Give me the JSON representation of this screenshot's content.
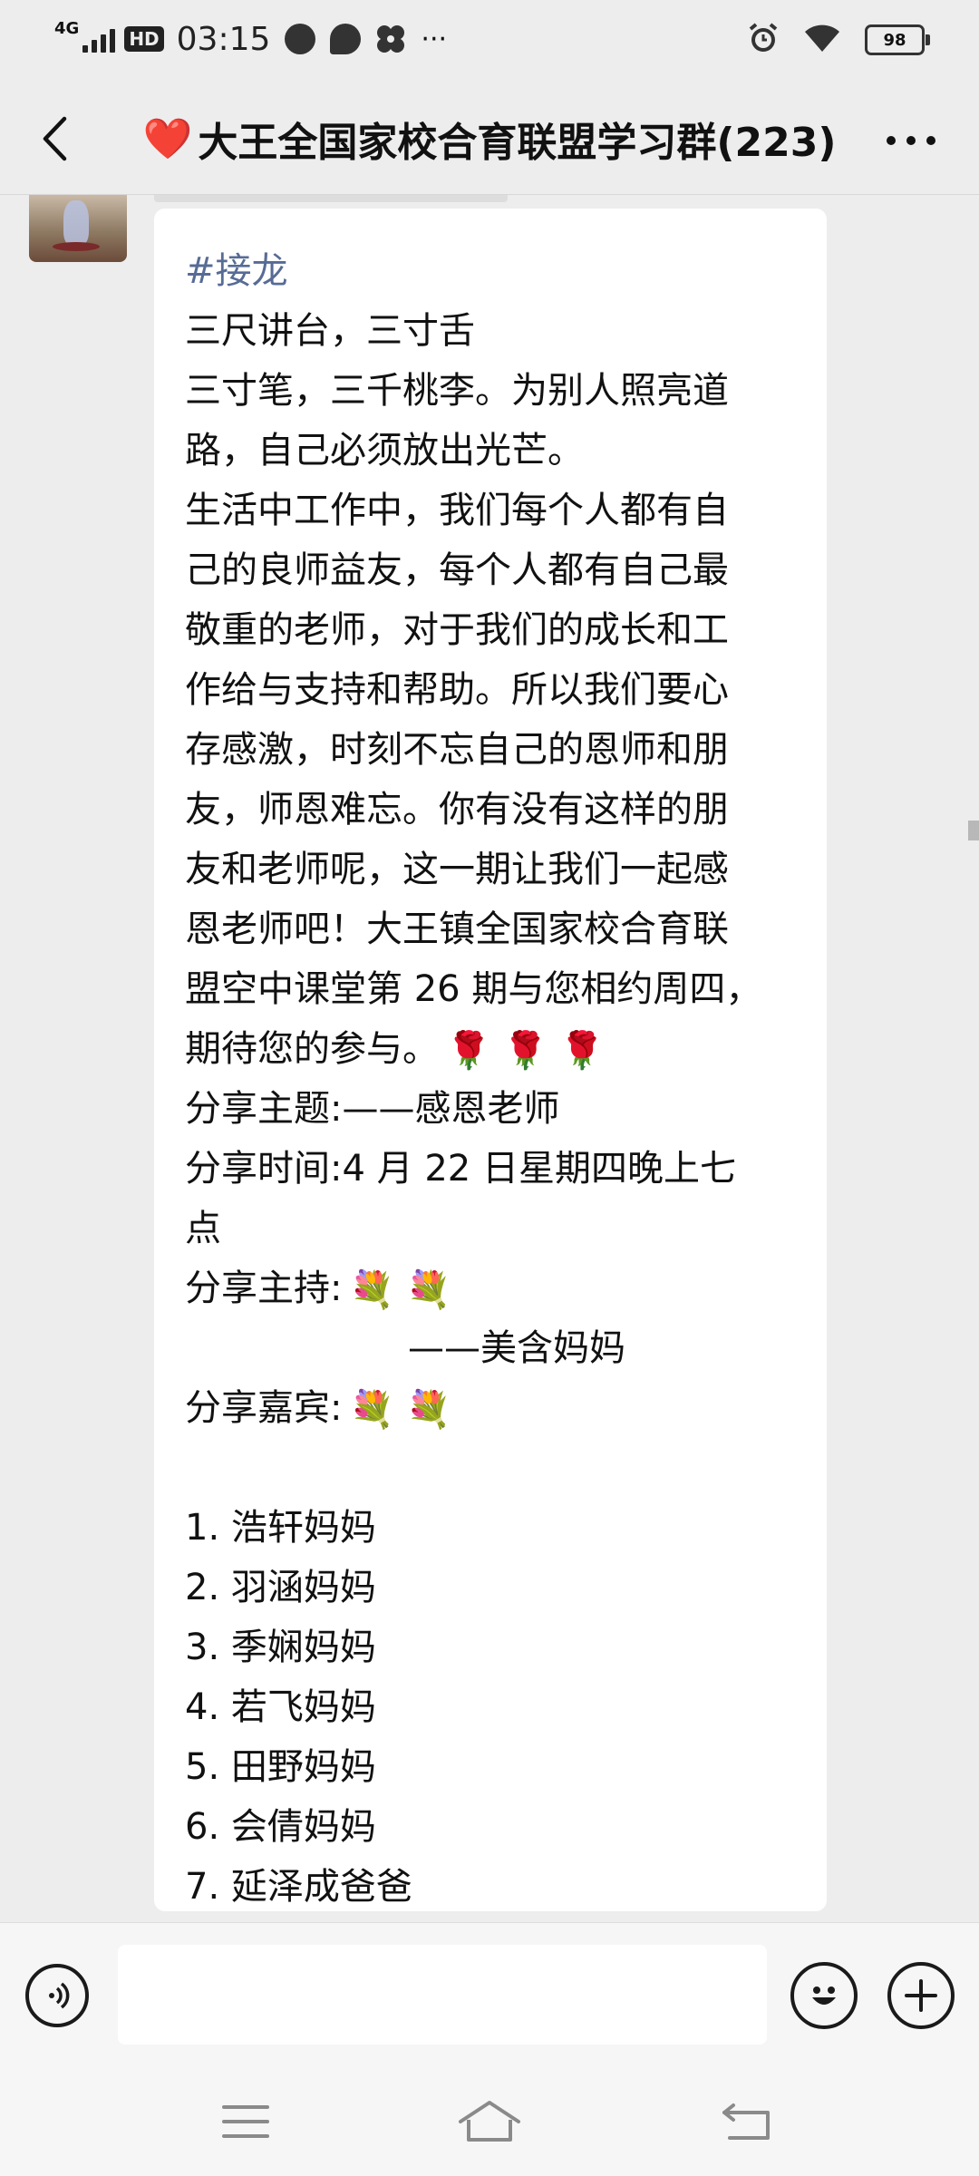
{
  "status_bar": {
    "network": "4G",
    "hd": "HD",
    "time": "03:15",
    "more": "···",
    "battery": "98"
  },
  "header": {
    "title_emoji": "❤️",
    "title": "大王全国家校合育联盟学习群(223)",
    "back_icon": "chevron-left-icon",
    "more_icon": "more-horizontal-icon"
  },
  "message": {
    "lines": [
      {
        "text": "#接龙",
        "style": "tag"
      },
      {
        "text": "三尺讲台，三寸舌"
      },
      {
        "text": "三寸笔，三千桃李。为别人照亮道"
      },
      {
        "text": "路，自己必须放出光芒。"
      },
      {
        "text": "生活中工作中，我们每个人都有自"
      },
      {
        "text": "己的良师益友，每个人都有自己最"
      },
      {
        "text": "敬重的老师，对于我们的成长和工"
      },
      {
        "text": "作给与支持和帮助。所以我们要心"
      },
      {
        "text": "存感激，时刻不忘自己的恩师和朋"
      },
      {
        "text": "友，师恩难忘。你有没有这样的朋"
      },
      {
        "text": "友和老师呢，这一期让我们一起感"
      },
      {
        "text": "恩老师吧！大王镇全国家校合育联"
      },
      {
        "text": "盟空中课堂第 26 期与您相约周四，"
      },
      {
        "text": "期待您的参与。",
        "emoji": "🌹 🌹 🌹"
      },
      {
        "text": "分享主题:——感恩老师"
      },
      {
        "text": "分享时间:4 月 22 日星期四晚上七"
      },
      {
        "text": "点"
      },
      {
        "text": "分享主持:",
        "emoji": "💐 💐"
      },
      {
        "text": "——美含妈妈",
        "style": "indent"
      },
      {
        "text": "分享嘉宾:",
        "emoji": "💐 💐"
      },
      {
        "text": "",
        "style": "blank"
      },
      {
        "text": "1. 浩轩妈妈"
      },
      {
        "text": "2. 羽涵妈妈"
      },
      {
        "text": "3. 季娴妈妈"
      },
      {
        "text": "4. 若飞妈妈"
      },
      {
        "text": "5. 田野妈妈"
      },
      {
        "text": "6. 会倩妈妈"
      },
      {
        "text": "7. 延泽成爸爸"
      }
    ]
  },
  "input_bar": {
    "voice_icon": "voice-icon",
    "input_value": "",
    "emoji_icon": "smiley-icon",
    "plus_icon": "plus-icon"
  },
  "system_nav": {
    "menu_icon": "menu-icon",
    "home_icon": "home-icon",
    "back_icon": "back-icon"
  },
  "colors": {
    "background": "#ededed",
    "bubble": "#ffffff",
    "tag_link": "#576b95",
    "text": "#111111"
  }
}
